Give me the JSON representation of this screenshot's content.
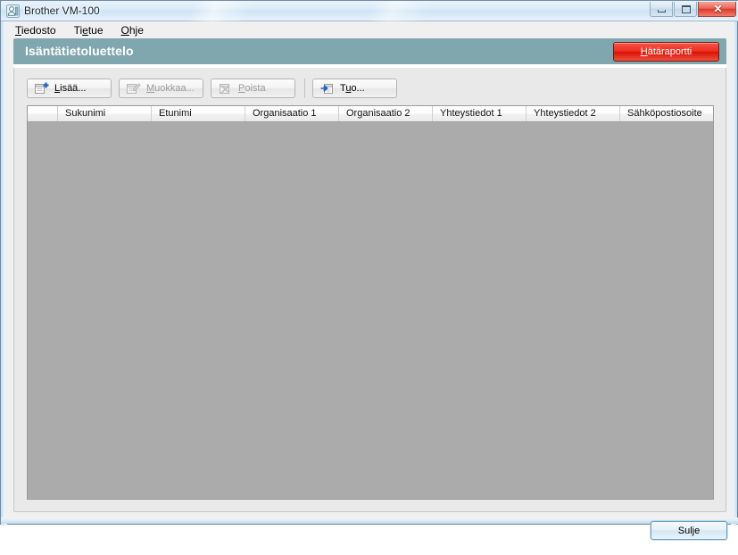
{
  "window": {
    "title": "Brother VM-100",
    "icon": "contact-person-icon",
    "controls": {
      "minimize": "–",
      "maximize": "□",
      "close": "✕"
    }
  },
  "menubar": {
    "items": [
      {
        "label": "Tiedosto",
        "mnemonic": "T"
      },
      {
        "label": "Tietue",
        "mnemonic": "e"
      },
      {
        "label": "Ohje",
        "mnemonic": "O"
      }
    ]
  },
  "header": {
    "title": "Isäntätietoluettelo",
    "band_color": "#7fa7ad",
    "emergency_button": {
      "label": "Hätäraportti",
      "mnemonic": "H",
      "color": "#ee2d1d"
    }
  },
  "toolbar": {
    "buttons": [
      {
        "name": "add",
        "label": "Lisää...",
        "icon": "add-record-icon",
        "enabled": true
      },
      {
        "name": "edit",
        "label": "Muokkaa...",
        "icon": "edit-record-icon",
        "enabled": false
      },
      {
        "name": "delete",
        "label": "Poista",
        "icon": "delete-record-icon",
        "enabled": false
      },
      {
        "name": "import",
        "label": "Tuo...",
        "icon": "import-icon",
        "enabled": true
      }
    ]
  },
  "grid": {
    "columns": [
      {
        "label": "",
        "width": 34
      },
      {
        "label": "Sukunimi",
        "width": 105
      },
      {
        "label": "Etunimi",
        "width": 105
      },
      {
        "label": "Organisaatio 1",
        "width": 105
      },
      {
        "label": "Organisaatio 2",
        "width": 105
      },
      {
        "label": "Yhteystiedot 1",
        "width": 105
      },
      {
        "label": "Yhteystiedot 2",
        "width": 105
      },
      {
        "label": "Sähköpostiosoite",
        "width": 104
      }
    ],
    "rows": [],
    "empty_background": "#ababab"
  },
  "footer": {
    "close_button": {
      "label": "Sulje"
    }
  }
}
